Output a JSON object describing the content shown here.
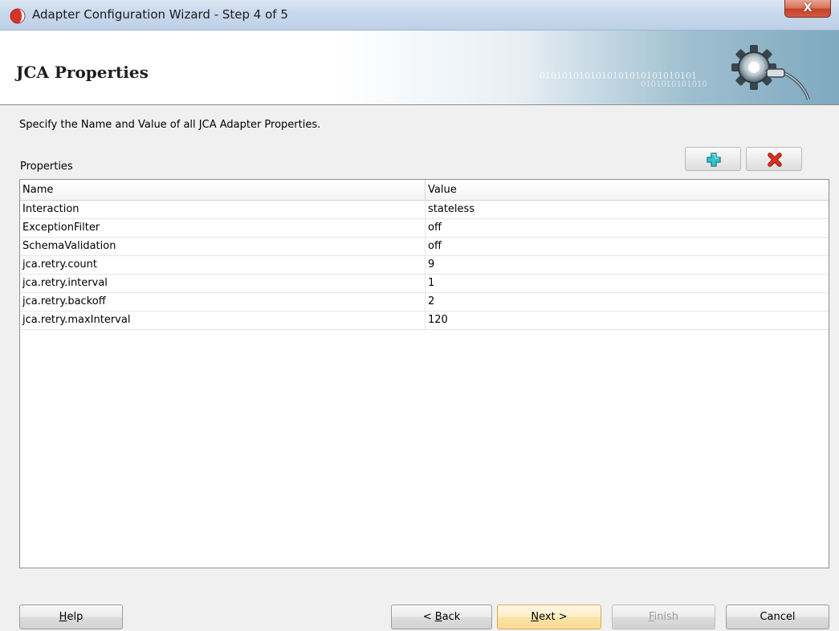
{
  "window": {
    "title": "Adapter Configuration Wizard - Step 4 of 5",
    "close_label": "X"
  },
  "header": {
    "title": "JCA Properties",
    "binary_line1": "0101010101010101010101010101",
    "binary_line2": "0101010101010"
  },
  "main": {
    "instructions": "Specify the Name and Value of all JCA Adapter Properties.",
    "properties_label": "Properties",
    "table": {
      "columns": [
        "Name",
        "Value"
      ],
      "rows": [
        {
          "name": "Interaction",
          "value": "stateless"
        },
        {
          "name": "ExceptionFilter",
          "value": "off"
        },
        {
          "name": "SchemaValidation",
          "value": "off"
        },
        {
          "name": "jca.retry.count",
          "value": "9"
        },
        {
          "name": "jca.retry.interval",
          "value": "1"
        },
        {
          "name": "jca.retry.backoff",
          "value": "2"
        },
        {
          "name": "jca.retry.maxInterval",
          "value": "120"
        }
      ]
    }
  },
  "toolbar": {
    "add_icon": "plus-icon",
    "remove_icon": "delete-x-icon",
    "add_color": "#2bb6c4",
    "remove_color": "#d42a1a"
  },
  "footer": {
    "help": {
      "mnemonic": "H",
      "rest": "elp"
    },
    "back": {
      "prefix": "< ",
      "mnemonic": "B",
      "rest": "ack"
    },
    "next": {
      "mnemonic": "N",
      "rest": "ext >"
    },
    "finish": {
      "mnemonic": "F",
      "rest": "inish"
    },
    "cancel": "Cancel"
  }
}
